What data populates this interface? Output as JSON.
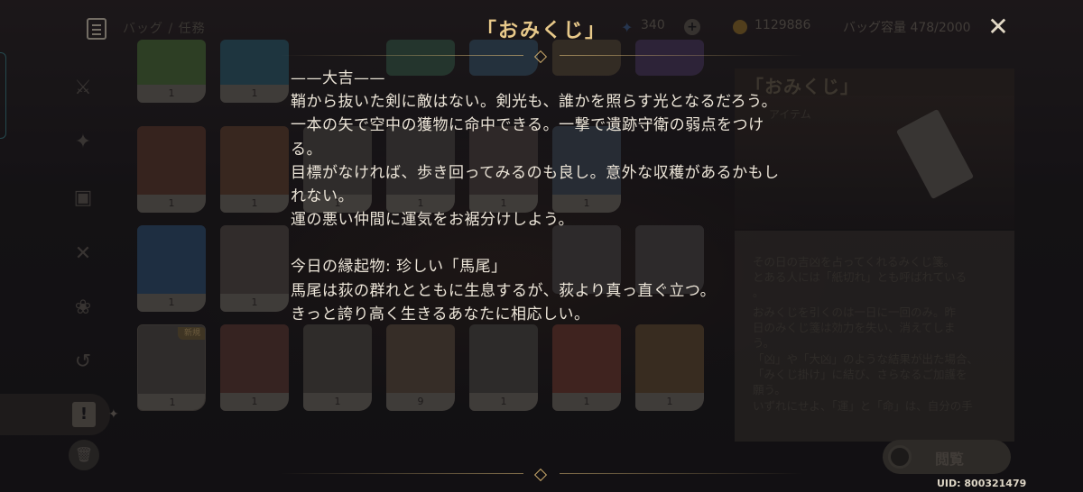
{
  "header": {
    "title": "「おみくじ」",
    "breadcrumb": "バッグ / 任務",
    "primogems": "340",
    "mora": "1129886",
    "capacity": "バッグ容量 478/2000"
  },
  "icons": {
    "menu": "list-icon",
    "close": "close-x-icon",
    "primogem": "primogem-star-icon",
    "mora": "mora-coin-icon",
    "add": "plus-icon"
  },
  "sidebar": {
    "items": [
      "weapon",
      "artifact",
      "character-development",
      "food",
      "materials",
      "gadget",
      "quest"
    ],
    "active": "quest"
  },
  "grid": {
    "quantities": [
      [
        "1",
        "1",
        "",
        "",
        "",
        ""
      ],
      [
        "1",
        "1",
        "1",
        "1",
        "1",
        "1"
      ],
      [
        "1",
        "1",
        "",
        "",
        "",
        ""
      ],
      [
        "1",
        "1",
        "1",
        "9",
        "1",
        "1",
        "1"
      ]
    ],
    "new_label": "新規"
  },
  "detail": {
    "name": "「おみくじ」",
    "subtype": "アイテム",
    "description": [
      "その日の吉凶を占ってくれるみくじ箋。",
      "とある人には「紙切れ」とも呼ばれている",
      "。",
      "おみくじを引くのは一日に一回のみ。昨",
      "日のみくじ箋は効力を失い、消えてしま",
      "う。",
      "「凶」や「大凶」のような結果が出た場合、",
      "「みくじ掛け」に結び、さらなるご加護を",
      "願う。",
      "いずれにせよ、「運」と「命」は、自分の手"
    ],
    "view_button": "閲覧"
  },
  "fortune": {
    "lines": [
      "——大吉——",
      "鞘から抜いた剣に敵はない。剣光も、誰かを照らす光となるだろう。",
      "一本の矢で空中の獲物に命中できる。一撃で遺跡守衛の弱点をつけ",
      "る。",
      "目標がなければ、歩き回ってみるのも良し。意外な収穫があるかもし",
      "れない。",
      "運の悪い仲間に運気をお裾分けしよう。",
      "",
      "今日の縁起物: 珍しい「馬尾」",
      "馬尾は荻の群れとともに生息するが、荻より真っ直ぐ立つ。",
      "きっと誇り高く生きるあなたに相応しい。"
    ]
  },
  "uid": "UID: 800321479",
  "colors": {
    "title": "#e8c98a",
    "text": "#ece5d8",
    "background": "#1b1a1e"
  }
}
